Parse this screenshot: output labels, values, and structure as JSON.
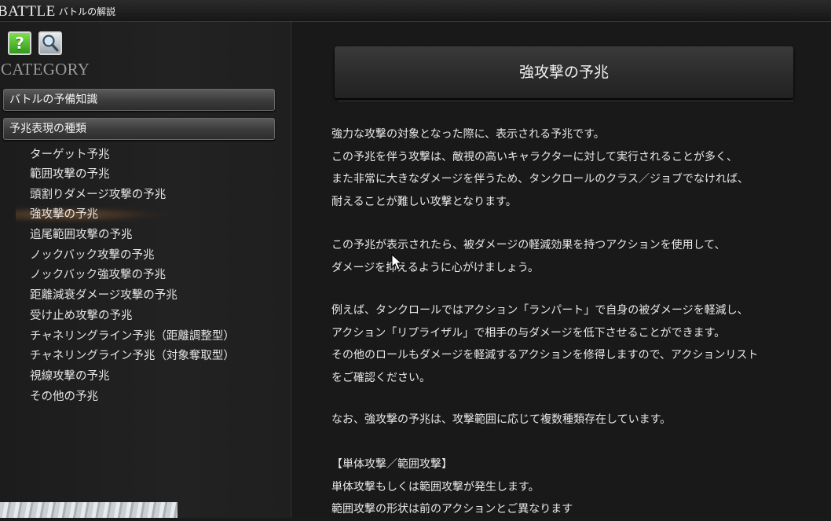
{
  "window": {
    "title_big": "BATTLE",
    "title_small": "バトルの解説"
  },
  "sidebar": {
    "icons": [
      "help-icon",
      "magnifier-icon"
    ],
    "category_label": "CATEGORY",
    "headers": [
      "バトルの予備知識",
      "予兆表現の種類"
    ],
    "items": [
      {
        "label": "ターゲット予兆"
      },
      {
        "label": "範囲攻撃の予兆"
      },
      {
        "label": "頭割りダメージ攻撃の予兆"
      },
      {
        "label": "強攻撃の予兆"
      },
      {
        "label": "追尾範囲攻撃の予兆"
      },
      {
        "label": "ノックバック攻撃の予兆"
      },
      {
        "label": "ノックバック強攻撃の予兆"
      },
      {
        "label": "距離減衰ダメージ攻撃の予兆"
      },
      {
        "label": "受け止め攻撃の予兆"
      },
      {
        "label": "チャネリングライン予兆（距離調整型）"
      },
      {
        "label": "チャネリングライン予兆（対象奪取型）"
      },
      {
        "label": "視線攻撃の予兆"
      },
      {
        "label": "その他の予兆"
      }
    ],
    "selected_index": 3
  },
  "content": {
    "title": "強攻撃の予兆",
    "paragraphs": [
      "強力な攻撃の対象となった際に、表示される予兆です。\nこの予兆を伴う攻撃は、敵視の高いキャラクターに対して実行されることが多く、\nまた非常に大きなダメージを伴うため、タンクロールのクラス／ジョブでなければ、\n耐えることが難しい攻撃となります。",
      "この予兆が表示されたら、被ダメージの軽減効果を持つアクションを使用して、\nダメージを抑えるように心がけましょう。",
      "例えば、タンクロールではアクション「ランパート」で自身の被ダメージを軽減し、\nアクション「リプライザル」で相手の与ダメージを低下させることができます。\nその他のロールもダメージを軽減するアクションを修得しますので、アクションリスト\nをご確認ください。",
      "なお、強攻撃の予兆は、攻撃範囲に応じて複数種類存在しています。",
      "【単体攻撃／範囲攻撃】\n単体攻撃もしくは範囲攻撃が発生します。\n範囲攻撃の形状は前のアクションとご異なります"
    ]
  }
}
